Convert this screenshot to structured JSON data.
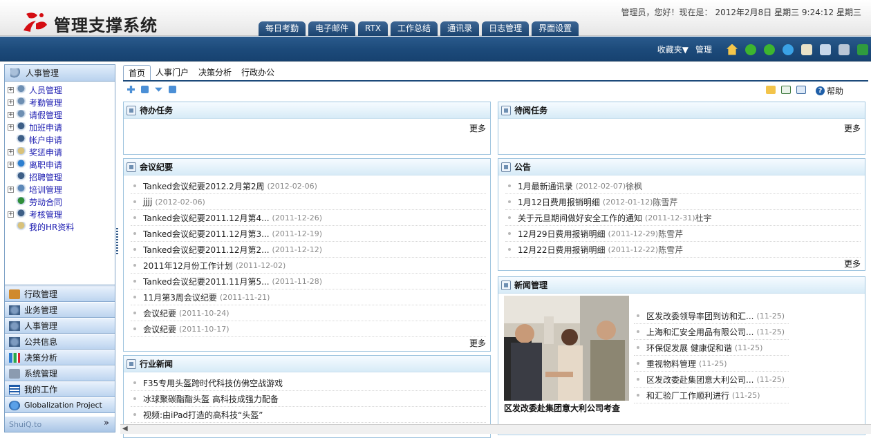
{
  "app": {
    "title": "管理支撑系统"
  },
  "header": {
    "greeting": "管理员，您好！现在是：",
    "datetime": "2012年2月8日 星期三 9:24:12 星期三",
    "tabs": [
      "每日考勤",
      "电子邮件",
      "RTX",
      "工作总结",
      "通讯录",
      "日志管理",
      "界面设置"
    ]
  },
  "toolbar": {
    "favorites": "收藏夹▼",
    "admin": "管理",
    "icons": [
      "home-icon",
      "back-icon",
      "forward-icon",
      "refresh-icon",
      "edit-icon",
      "user-settings-icon",
      "tools-icon",
      "exit-icon"
    ]
  },
  "sidebar": {
    "title": "人事管理",
    "tree": [
      {
        "label": "人员管理",
        "expandable": true,
        "icon": "users-icon"
      },
      {
        "label": "考勤管理",
        "expandable": true,
        "icon": "users-icon"
      },
      {
        "label": "请假管理",
        "expandable": true,
        "icon": "users-icon"
      },
      {
        "label": "加班申请",
        "expandable": true,
        "icon": "user-icon"
      },
      {
        "label": "帐户申请",
        "expandable": false,
        "icon": "user-icon"
      },
      {
        "label": "奖惩申请",
        "expandable": true,
        "icon": "document-icon"
      },
      {
        "label": "离职申请",
        "expandable": true,
        "icon": "globe-icon"
      },
      {
        "label": "招聘管理",
        "expandable": false,
        "icon": "user-icon"
      },
      {
        "label": "培训管理",
        "expandable": true,
        "icon": "training-icon"
      },
      {
        "label": "劳动合同",
        "expandable": false,
        "icon": "contract-icon"
      },
      {
        "label": "考核管理",
        "expandable": true,
        "icon": "user-icon"
      },
      {
        "label": "我的HR资料",
        "expandable": false,
        "icon": "document-icon"
      }
    ],
    "modules": [
      "行政管理",
      "业务管理",
      "人事管理",
      "公共信息",
      "决策分析",
      "系统管理",
      "我的工作",
      "Globalization Project"
    ],
    "footer": "ShuiQ.to"
  },
  "content": {
    "tabs": [
      "首页",
      "人事门户",
      "决策分析",
      "行政办公"
    ],
    "help": "帮助",
    "more": "更多",
    "todo": {
      "title": "待办任务"
    },
    "toread": {
      "title": "待阅任务"
    },
    "meetings": {
      "title": "会议纪要",
      "items": [
        {
          "title": "Tanked会议纪要2012.2月第2周",
          "date": "(2012-02-06)"
        },
        {
          "title": "jjjj",
          "date": "(2012-02-06)"
        },
        {
          "title": "Tanked会议纪要2011.12月第4...",
          "date": "(2011-12-26)"
        },
        {
          "title": "Tanked会议纪要2011.12月第3...",
          "date": "(2011-12-19)"
        },
        {
          "title": "Tanked会议纪要2011.12月第2...",
          "date": "(2011-12-12)"
        },
        {
          "title": "2011年12月份工作计划",
          "date": "(2011-12-02)"
        },
        {
          "title": "Tanked会议纪要2011.11月第5...",
          "date": "(2011-11-28)"
        },
        {
          "title": "11月第3周会议纪要",
          "date": "(2011-11-21)"
        },
        {
          "title": "会议纪要",
          "date": "(2011-10-24)"
        },
        {
          "title": "会议纪要",
          "date": "(2011-10-17)"
        }
      ]
    },
    "notices": {
      "title": "公告",
      "items": [
        {
          "title": "1月最新通讯录",
          "date": "(2012-02-07)",
          "author": "徐枫"
        },
        {
          "title": "1月12日费用报销明细",
          "date": "(2012-01-12)",
          "author": "陈雪芹"
        },
        {
          "title": "关于元旦期间做好安全工作的通知",
          "date": "(2011-12-31)",
          "author": "杜宇"
        },
        {
          "title": "12月29日费用报销明细",
          "date": "(2011-12-29)",
          "author": "陈雪芹"
        },
        {
          "title": "12月22日费用报销明细",
          "date": "(2011-12-22)",
          "author": "陈雪芹"
        }
      ]
    },
    "industry": {
      "title": "行业新闻",
      "items": [
        {
          "title": "F35专用头盔跨时代科技仿佛空战游戏"
        },
        {
          "title": "冰球聚碳酯酯头盔 高科技成强力配备"
        },
        {
          "title": "视频:由iPad打造的高科技“头盔”"
        }
      ]
    },
    "news": {
      "title": "新闻管理",
      "caption": "区发改委赴集团意大利公司考查",
      "items": [
        {
          "title": "区发改委领导率团到访和汇...",
          "date": "(11-25)"
        },
        {
          "title": "上海和汇安全用品有限公司...",
          "date": "(11-25)"
        },
        {
          "title": "环保促发展 健康促和谐",
          "date": "(11-25)"
        },
        {
          "title": "重视物料管理",
          "date": "(11-25)"
        },
        {
          "title": "区发改委赴集团意大利公司...",
          "date": "(11-25)"
        },
        {
          "title": "和汇验厂工作顺利进行",
          "date": "(11-25)"
        }
      ]
    }
  }
}
